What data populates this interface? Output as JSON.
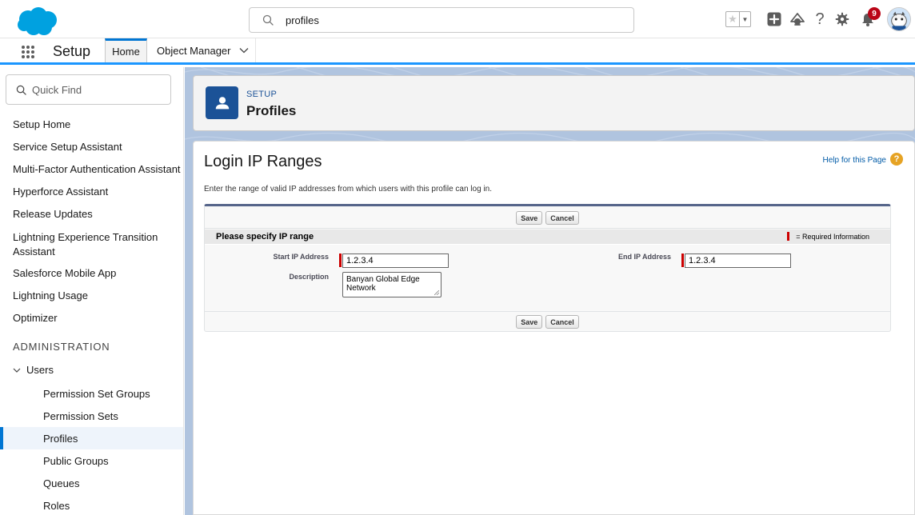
{
  "header": {
    "search_value": "profiles",
    "notification_count": "9",
    "icons": [
      "salesforce-logo",
      "search-icon",
      "favorites-star-icon",
      "favorites-dropdown-icon",
      "global-actions-plus-icon",
      "trailhead-icon",
      "help-icon",
      "gear-icon",
      "bell-icon",
      "user-avatar"
    ]
  },
  "context_bar": {
    "app_name": "Setup",
    "tabs": [
      {
        "label": "Home",
        "active": true
      },
      {
        "label": "Object Manager",
        "active": false
      }
    ]
  },
  "left_nav": {
    "quick_find_placeholder": "Quick Find",
    "items": [
      "Setup Home",
      "Service Setup Assistant",
      "Multi-Factor Authentication Assistant",
      "Hyperforce Assistant",
      "Release Updates",
      "Lightning Experience Transition Assistant",
      "Salesforce Mobile App",
      "Lightning Usage",
      "Optimizer"
    ],
    "section": "ADMINISTRATION",
    "group": "Users",
    "sub_items": [
      {
        "label": "Permission Set Groups",
        "active": false
      },
      {
        "label": "Permission Sets",
        "active": false
      },
      {
        "label": "Profiles",
        "active": true
      },
      {
        "label": "Public Groups",
        "active": false
      },
      {
        "label": "Queues",
        "active": false
      },
      {
        "label": "Roles",
        "active": false
      }
    ]
  },
  "page_header": {
    "kicker": "SETUP",
    "title": "Profiles"
  },
  "content": {
    "title": "Login IP Ranges",
    "help_link": "Help for this Page",
    "instruction": "Enter the range of valid IP addresses from which users with this profile can log in.",
    "buttons": {
      "save": "Save",
      "cancel": "Cancel"
    },
    "section_title": "Please specify IP range",
    "required_legend": "= Required Information",
    "fields": {
      "start_ip_label": "Start IP Address",
      "start_ip_value": "1.2.3.4",
      "end_ip_label": "End IP Address",
      "end_ip_value": "1.2.3.4",
      "description_label": "Description",
      "description_value": "Banyan Global Edge Network"
    }
  },
  "colors": {
    "brand_blue": "#0176d3",
    "required_red": "#cc0000",
    "profile_icon_bg": "#1b5297",
    "notification_red": "#ba0517"
  }
}
